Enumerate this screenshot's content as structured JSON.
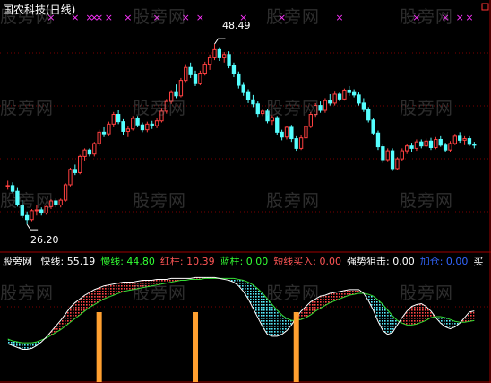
{
  "title": "国农科技(日线)",
  "chart_data": [
    {
      "type": "candlestick",
      "title": "国农科技(日线)",
      "high_label": "48.49",
      "low_label": "26.20",
      "price_range": [
        24.0,
        51.5
      ],
      "marker_symbol": "×",
      "marker_color": "#ff33ff",
      "marker_bars": [
        9,
        14,
        17,
        18,
        19,
        21,
        25,
        31,
        37,
        40,
        49,
        57,
        69,
        85,
        91,
        94,
        96
      ],
      "colors": {
        "up": "#ff4040",
        "down": "#55ffff"
      },
      "candles": [
        [
          30.9,
          31.6,
          30.5,
          31.0
        ],
        [
          31.0,
          31.4,
          30.1,
          30.3
        ],
        [
          30.3,
          30.7,
          28.4,
          28.6
        ],
        [
          28.6,
          29.2,
          27.0,
          27.3
        ],
        [
          27.3,
          27.8,
          26.2,
          26.8
        ],
        [
          26.8,
          28.1,
          26.6,
          27.9
        ],
        [
          27.9,
          28.6,
          27.3,
          28.0
        ],
        [
          28.0,
          28.3,
          27.3,
          27.6
        ],
        [
          27.6,
          28.5,
          27.4,
          28.4
        ],
        [
          28.4,
          29.3,
          28.1,
          29.1
        ],
        [
          29.1,
          29.4,
          28.3,
          28.6
        ],
        [
          28.6,
          29.4,
          28.3,
          29.2
        ],
        [
          29.2,
          31.3,
          29.0,
          31.1
        ],
        [
          31.1,
          33.2,
          30.9,
          33.0
        ],
        [
          33.0,
          33.6,
          32.3,
          32.6
        ],
        [
          32.6,
          34.8,
          32.4,
          34.6
        ],
        [
          34.6,
          35.6,
          34.1,
          35.4
        ],
        [
          35.4,
          35.6,
          34.6,
          34.9
        ],
        [
          34.9,
          36.4,
          34.6,
          36.2
        ],
        [
          36.2,
          37.9,
          35.9,
          37.6
        ],
        [
          37.6,
          38.2,
          37.0,
          37.4
        ],
        [
          37.4,
          38.9,
          37.1,
          38.6
        ],
        [
          38.6,
          40.1,
          38.2,
          39.8
        ],
        [
          39.8,
          40.3,
          38.6,
          38.9
        ],
        [
          38.9,
          39.2,
          37.3,
          37.7
        ],
        [
          37.7,
          38.3,
          37.0,
          38.0
        ],
        [
          38.0,
          39.6,
          37.8,
          39.3
        ],
        [
          39.3,
          39.6,
          38.2,
          38.5
        ],
        [
          38.5,
          38.8,
          37.6,
          37.9
        ],
        [
          37.9,
          38.9,
          37.6,
          38.6
        ],
        [
          38.6,
          39.0,
          38.0,
          38.4
        ],
        [
          38.4,
          39.4,
          38.1,
          39.0
        ],
        [
          39.0,
          40.6,
          38.8,
          40.2
        ],
        [
          40.2,
          41.7,
          39.9,
          41.4
        ],
        [
          41.4,
          42.8,
          41.1,
          42.5
        ],
        [
          42.5,
          43.5,
          41.8,
          42.1
        ],
        [
          42.1,
          44.3,
          41.9,
          44.0
        ],
        [
          44.0,
          46.0,
          43.8,
          45.6
        ],
        [
          45.6,
          46.2,
          44.3,
          44.7
        ],
        [
          44.7,
          45.2,
          43.3,
          43.6
        ],
        [
          43.6,
          45.2,
          43.4,
          44.9
        ],
        [
          44.9,
          46.3,
          44.6,
          46.0
        ],
        [
          46.0,
          47.2,
          45.3,
          46.8
        ],
        [
          46.8,
          48.49,
          46.5,
          47.8
        ],
        [
          47.8,
          48.1,
          46.4,
          46.8
        ],
        [
          46.8,
          47.5,
          46.2,
          47.2
        ],
        [
          47.2,
          47.6,
          45.5,
          45.8
        ],
        [
          45.8,
          46.2,
          44.4,
          44.8
        ],
        [
          44.8,
          45.1,
          43.0,
          43.4
        ],
        [
          43.4,
          43.8,
          42.1,
          42.5
        ],
        [
          42.5,
          42.9,
          41.2,
          41.6
        ],
        [
          41.6,
          42.2,
          40.7,
          41.1
        ],
        [
          41.1,
          41.4,
          39.5,
          39.9
        ],
        [
          39.9,
          40.5,
          39.6,
          40.2
        ],
        [
          40.2,
          40.5,
          38.7,
          39.0
        ],
        [
          39.0,
          39.7,
          38.5,
          39.4
        ],
        [
          39.4,
          39.6,
          37.2,
          37.6
        ],
        [
          37.6,
          37.9,
          36.6,
          37.0
        ],
        [
          37.0,
          38.4,
          36.7,
          38.2
        ],
        [
          38.2,
          38.5,
          36.4,
          36.8
        ],
        [
          36.8,
          37.1,
          35.3,
          35.6
        ],
        [
          35.6,
          37.2,
          35.4,
          36.9
        ],
        [
          36.9,
          38.6,
          36.7,
          38.3
        ],
        [
          38.3,
          40.1,
          38.1,
          39.8
        ],
        [
          39.8,
          41.2,
          39.5,
          40.9
        ],
        [
          40.9,
          41.4,
          40.0,
          40.3
        ],
        [
          40.3,
          41.8,
          40.0,
          41.5
        ],
        [
          41.5,
          42.3,
          40.9,
          41.2
        ],
        [
          41.2,
          42.6,
          40.9,
          42.3
        ],
        [
          42.3,
          42.5,
          41.4,
          41.7
        ],
        [
          41.7,
          43.0,
          41.5,
          42.8
        ],
        [
          42.8,
          43.3,
          42.1,
          42.5
        ],
        [
          42.5,
          42.9,
          41.9,
          42.2
        ],
        [
          42.2,
          42.5,
          40.9,
          41.2
        ],
        [
          41.2,
          41.8,
          40.1,
          40.4
        ],
        [
          40.4,
          40.7,
          38.8,
          39.1
        ],
        [
          39.1,
          39.4,
          37.2,
          37.5
        ],
        [
          37.5,
          37.8,
          35.4,
          35.8
        ],
        [
          35.8,
          36.2,
          33.8,
          34.2
        ],
        [
          34.2,
          35.6,
          33.9,
          35.3
        ],
        [
          35.3,
          35.6,
          32.8,
          33.1
        ],
        [
          33.1,
          34.5,
          32.9,
          34.3
        ],
        [
          34.3,
          35.6,
          34.0,
          35.3
        ],
        [
          35.3,
          36.2,
          34.9,
          35.9
        ],
        [
          35.9,
          36.3,
          35.2,
          35.6
        ],
        [
          35.6,
          36.7,
          35.3,
          36.4
        ],
        [
          36.4,
          36.7,
          35.6,
          35.9
        ],
        [
          35.9,
          36.8,
          35.7,
          36.5
        ],
        [
          36.5,
          36.9,
          35.4,
          35.7
        ],
        [
          35.7,
          37.0,
          35.5,
          36.7
        ],
        [
          36.7,
          37.1,
          35.8,
          36.0
        ],
        [
          36.0,
          36.3,
          35.1,
          35.4
        ],
        [
          35.4,
          36.5,
          35.2,
          36.2
        ],
        [
          36.2,
          37.4,
          36.0,
          37.1
        ],
        [
          37.1,
          37.6,
          36.3,
          36.6
        ],
        [
          36.6,
          37.1,
          36.0,
          36.8
        ],
        [
          36.8,
          37.1,
          35.9,
          36.1
        ],
        [
          36.1,
          36.4,
          35.6,
          36.0
        ]
      ]
    },
    {
      "type": "indicator",
      "name": "股旁网",
      "legend": [
        {
          "label": "快线",
          "value": "55.19",
          "color": "#ffffff"
        },
        {
          "label": "慢线",
          "value": "44.80",
          "color": "#33ff33"
        },
        {
          "label": "红柱",
          "value": "10.39",
          "color": "#ff5555"
        },
        {
          "label": "蓝柱",
          "value": "0.00",
          "color": "#33ff33"
        },
        {
          "label": "短线买入",
          "value": "0.00",
          "color": "#ff5555"
        },
        {
          "label": "强势狙击",
          "value": "0.00",
          "color": "#ffffff"
        },
        {
          "label": "加仓",
          "value": "0.00",
          "color": "#3366ff"
        },
        {
          "label": "买",
          "value": "",
          "color": "#ffffff"
        }
      ],
      "y_range": [
        0,
        100
      ],
      "fast": [
        20,
        18,
        16,
        14,
        14,
        15,
        18,
        22,
        27,
        33,
        39,
        45,
        52,
        59,
        64,
        68,
        72,
        75,
        78,
        80,
        82,
        83,
        84,
        85,
        86,
        86,
        86,
        87,
        88,
        88,
        88,
        89,
        89,
        89,
        90,
        90,
        90,
        90,
        90,
        91,
        91,
        91,
        91,
        91,
        90,
        89,
        88,
        86,
        82,
        76,
        68,
        58,
        48,
        38,
        30,
        28,
        28,
        30,
        34,
        40,
        48,
        55,
        60,
        65,
        68,
        71,
        72,
        74,
        75,
        76,
        77,
        78,
        78,
        78,
        74,
        66,
        56,
        44,
        34,
        30,
        32,
        40,
        48,
        55,
        60,
        62,
        63,
        60,
        55,
        48,
        42,
        38,
        36,
        38,
        42,
        48,
        54,
        55.19
      ],
      "slow": [
        25,
        23,
        22,
        21,
        21,
        21,
        22,
        24,
        26,
        29,
        32,
        35,
        39,
        43,
        47,
        51,
        55,
        59,
        62,
        65,
        68,
        70,
        72,
        74,
        76,
        77,
        78,
        79,
        80,
        81,
        82,
        83,
        84,
        85,
        86,
        87,
        88,
        88,
        89,
        89,
        89,
        90,
        90,
        90,
        90,
        90,
        90,
        90,
        89,
        88,
        86,
        83,
        79,
        74,
        68,
        62,
        56,
        51,
        47,
        45,
        45,
        46,
        48,
        51,
        55,
        58,
        61,
        64,
        66,
        68,
        70,
        72,
        73,
        74,
        74,
        73,
        71,
        67,
        62,
        56,
        50,
        45,
        42,
        40,
        40,
        41,
        43,
        45,
        48,
        49,
        49,
        48,
        46,
        44,
        43,
        43,
        44,
        44.8
      ],
      "buy_bars": [
        19,
        39,
        60
      ]
    }
  ]
}
